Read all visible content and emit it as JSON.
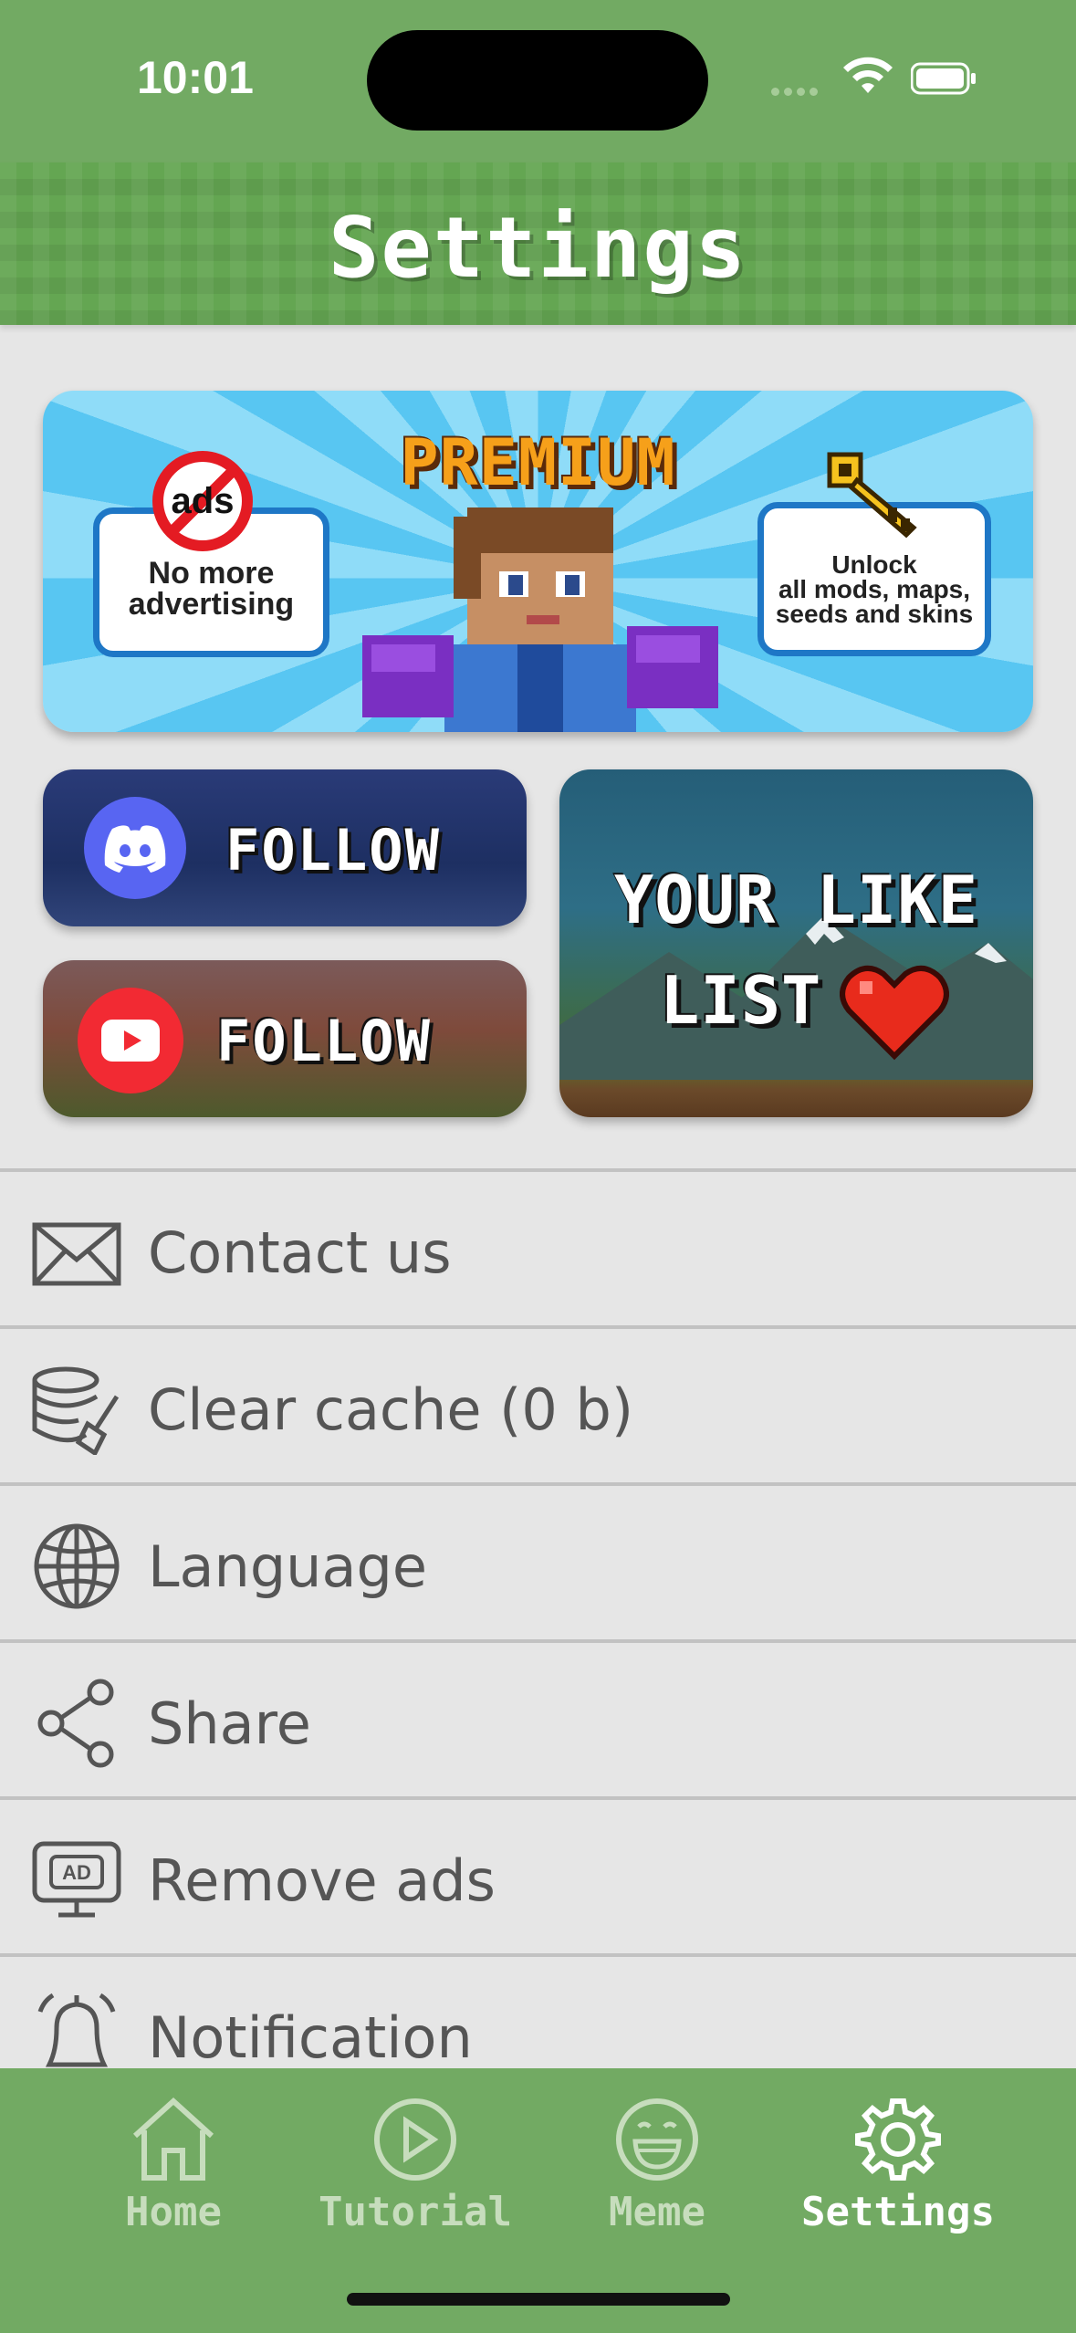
{
  "status_bar": {
    "time": "10:01"
  },
  "header": {
    "title": "Settings"
  },
  "premium_banner": {
    "title": "PREMIUM",
    "ads_badge": "ads",
    "no_ads_text": "No more advertising",
    "unlock_title": "Unlock",
    "unlock_text": "all mods, maps, seeds and skins"
  },
  "social": {
    "discord_label": "FOLLOW",
    "youtube_label": "FOLLOW",
    "like_list_line1": "YOUR LIKE",
    "like_list_line2": "LIST"
  },
  "settings_list": {
    "items": [
      {
        "label": "Contact us",
        "icon": "envelope-icon"
      },
      {
        "label": "Clear cache (0 b)",
        "icon": "database-broom-icon"
      },
      {
        "label": "Language",
        "icon": "globe-icon"
      },
      {
        "label": "Share",
        "icon": "share-icon"
      },
      {
        "label": "Remove ads",
        "icon": "ad-monitor-icon"
      },
      {
        "label": "Notification",
        "icon": "bell-icon"
      }
    ]
  },
  "tab_bar": {
    "tabs": [
      {
        "label": "Home",
        "icon": "house-icon"
      },
      {
        "label": "Tutorial",
        "icon": "play-circle-icon"
      },
      {
        "label": "Meme",
        "icon": "smiley-icon"
      },
      {
        "label": "Settings",
        "icon": "gear-icon"
      }
    ],
    "active": "Settings"
  },
  "colors": {
    "green_bar": "#72aa63",
    "header_green": "#64a652",
    "background": "#e6e6e6",
    "list_text": "#555555",
    "tab_inactive": "#c7ddbd",
    "tab_active": "#ffffff"
  }
}
